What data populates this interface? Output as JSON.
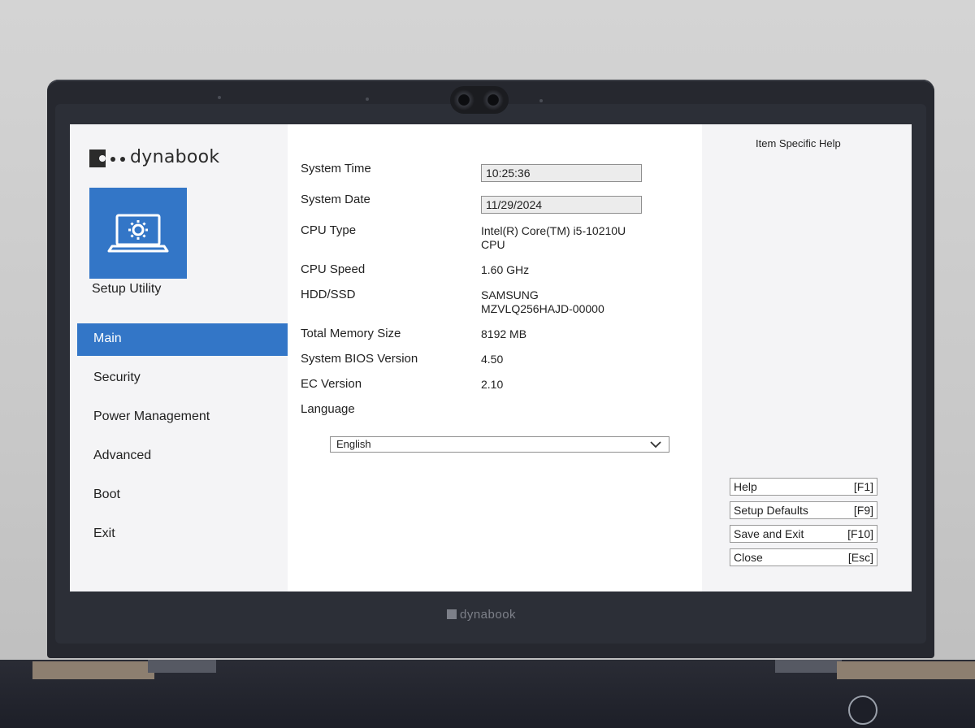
{
  "brand": {
    "name": "dynabook"
  },
  "sidebar": {
    "setup_label": "Setup Utility",
    "items": [
      {
        "label": "Main",
        "active": true
      },
      {
        "label": "Security"
      },
      {
        "label": "Power Management"
      },
      {
        "label": "Advanced"
      },
      {
        "label": "Boot"
      },
      {
        "label": "Exit"
      }
    ]
  },
  "main": {
    "system_time": {
      "label": "System Time",
      "value": "10:25:36"
    },
    "system_date": {
      "label": "System Date",
      "value": "11/29/2024"
    },
    "cpu_type": {
      "label": "CPU Type",
      "value_line1": "Intel(R) Core(TM) i5-10210U",
      "value_line2": "CPU"
    },
    "cpu_speed": {
      "label": "CPU Speed",
      "value": "1.60 GHz"
    },
    "hdd_ssd": {
      "label": "HDD/SSD",
      "value_line1": "SAMSUNG",
      "value_line2": "MZVLQ256HAJD-00000"
    },
    "total_memory": {
      "label": "Total Memory Size",
      "value": "8192 MB"
    },
    "bios_version": {
      "label": "System BIOS Version",
      "value": "4.50"
    },
    "ec_version": {
      "label": "EC Version",
      "value": "2.10"
    },
    "language": {
      "label": "Language",
      "selected": "English"
    }
  },
  "help": {
    "title": "Item Specific Help",
    "keys": [
      {
        "label": "Help",
        "key": "[F1]"
      },
      {
        "label": "Setup Defaults",
        "key": "[F9]"
      },
      {
        "label": "Save and Exit",
        "key": "[F10]"
      },
      {
        "label": "Close",
        "key": "[Esc]"
      }
    ]
  },
  "bezel_logo": "dynabook",
  "colors": {
    "accent": "#3376c7",
    "panel": "#f4f4f6",
    "bezel": "#26282f"
  },
  "icons": [
    "settings-laptop-icon",
    "chevron-down-icon",
    "webcam-icon",
    "power-icon"
  ]
}
